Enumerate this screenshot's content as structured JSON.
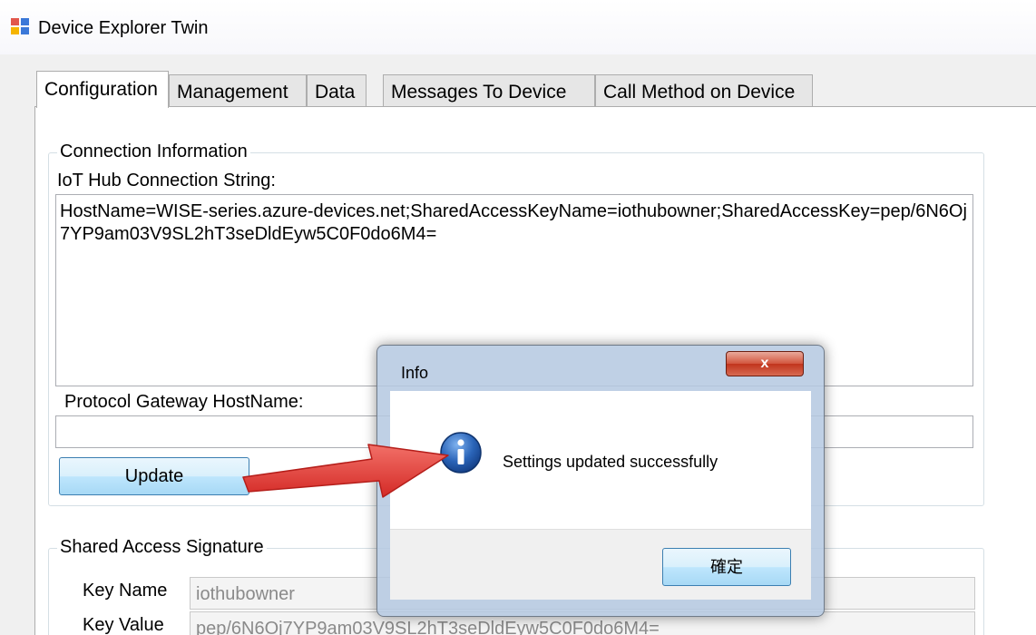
{
  "window": {
    "title": "Device Explorer Twin"
  },
  "tabs": [
    {
      "label": "Configuration",
      "active": true
    },
    {
      "label": "Management"
    },
    {
      "label": "Data"
    },
    {
      "label": "Messages To Device"
    },
    {
      "label": "Call Method on Device"
    }
  ],
  "connection": {
    "group_title": "Connection Information",
    "conn_label": "IoT Hub Connection String:",
    "conn_value": "HostName=WISE-series.azure-devices.net;SharedAccessKeyName=iothubowner;SharedAccessKey=pep/6N6Oj7YP9am03V9SL2hT3seDldEyw5C0F0do6M4=",
    "gateway_label": "Protocol Gateway HostName:",
    "gateway_value": "",
    "update_label": "Update"
  },
  "sas": {
    "group_title": "Shared Access Signature",
    "key_name_label": "Key Name",
    "key_name_value": "iothubowner",
    "key_value_label": "Key Value",
    "key_value_value": "pep/6N6Oj7YP9am03V9SL2hT3seDldEyw5C0F0do6M4="
  },
  "dialog": {
    "title": "Info",
    "close_label": "x",
    "message": "Settings updated successfully",
    "ok_label": "確定"
  },
  "colors": {
    "button_border": "#3c7fb1",
    "close_red": "#c1341c",
    "arrow_red": "#e8413d",
    "info_blue": "#1f5aa8"
  }
}
